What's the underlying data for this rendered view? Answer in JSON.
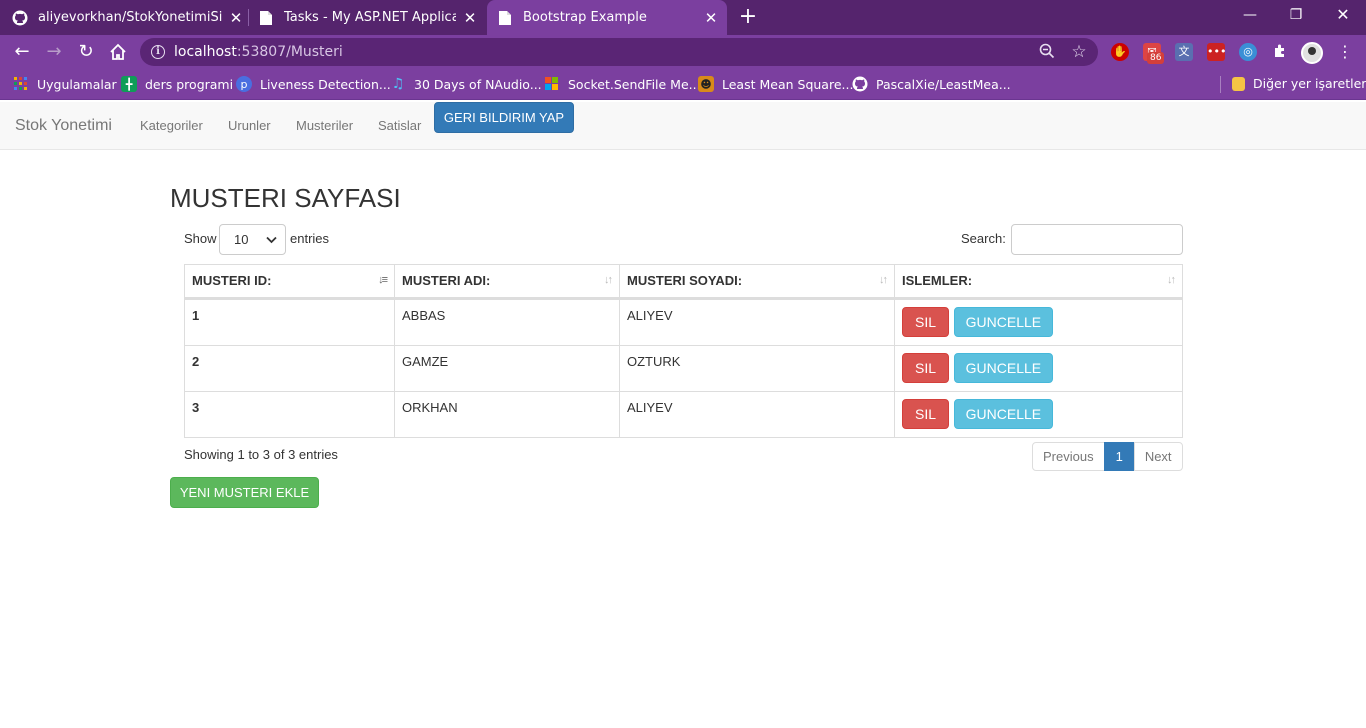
{
  "browser": {
    "tabs": [
      {
        "title": "aliyevorkhan/StokYonetimiSistemi",
        "icon": "github-icon"
      },
      {
        "title": "Tasks - My ASP.NET Application",
        "icon": "page-icon"
      },
      {
        "title": "Bootstrap Example",
        "icon": "page-icon"
      }
    ],
    "url_host": "localhost",
    "url_path": ":53807/Musteri",
    "extension_badge": "86",
    "bookmarks": [
      {
        "label": "Uygulamalar",
        "icon": "apps-grid-icon"
      },
      {
        "label": "ders programi",
        "icon": "sheet-icon"
      },
      {
        "label": "Liveness Detection...",
        "icon": "p-icon"
      },
      {
        "label": "30 Days of NAudio...",
        "icon": "music-icon"
      },
      {
        "label": "Socket.SendFile Me...",
        "icon": "windows-icon"
      },
      {
        "label": "Least Mean Square...",
        "icon": "site-icon"
      },
      {
        "label": "PascalXie/LeastMea...",
        "icon": "github-icon"
      }
    ],
    "other_bookmarks": "Diğer yer işaretleri"
  },
  "navbar": {
    "brand": "Stok Yonetimi",
    "links": [
      "Kategoriler",
      "Urunler",
      "Musteriler",
      "Satislar"
    ],
    "feedback_button": "GERI BILDIRIM YAP"
  },
  "page": {
    "title": "MUSTERI SAYFASI",
    "show_label": "Show",
    "entries_label": "entries",
    "page_length": "10",
    "search_label": "Search:",
    "search_value": "",
    "columns": [
      "MUSTERI ID:",
      "MUSTERI ADI:",
      "MUSTERI SOYADI:",
      "ISLEMLER:"
    ],
    "rows": [
      {
        "id": "1",
        "ad": "ABBAS",
        "soyad": "ALIYEV",
        "sil": "SIL",
        "guncelle": "GUNCELLE"
      },
      {
        "id": "2",
        "ad": "GAMZE",
        "soyad": "OZTURK",
        "sil": "SIL",
        "guncelle": "GUNCELLE"
      },
      {
        "id": "3",
        "ad": "ORKHAN",
        "soyad": "ALIYEV",
        "sil": "SIL",
        "guncelle": "GUNCELLE"
      }
    ],
    "info": "Showing 1 to 3 of 3 entries",
    "pagination": {
      "previous": "Previous",
      "current": "1",
      "next": "Next"
    },
    "add_button": "YENI MUSTERI EKLE"
  },
  "colors": {
    "browser_frame": "#55246d",
    "browser_toolbar": "#7b3f9f",
    "primary": "#337ab7",
    "danger": "#d9534f",
    "info": "#5bc0de",
    "success": "#5cb85c"
  }
}
